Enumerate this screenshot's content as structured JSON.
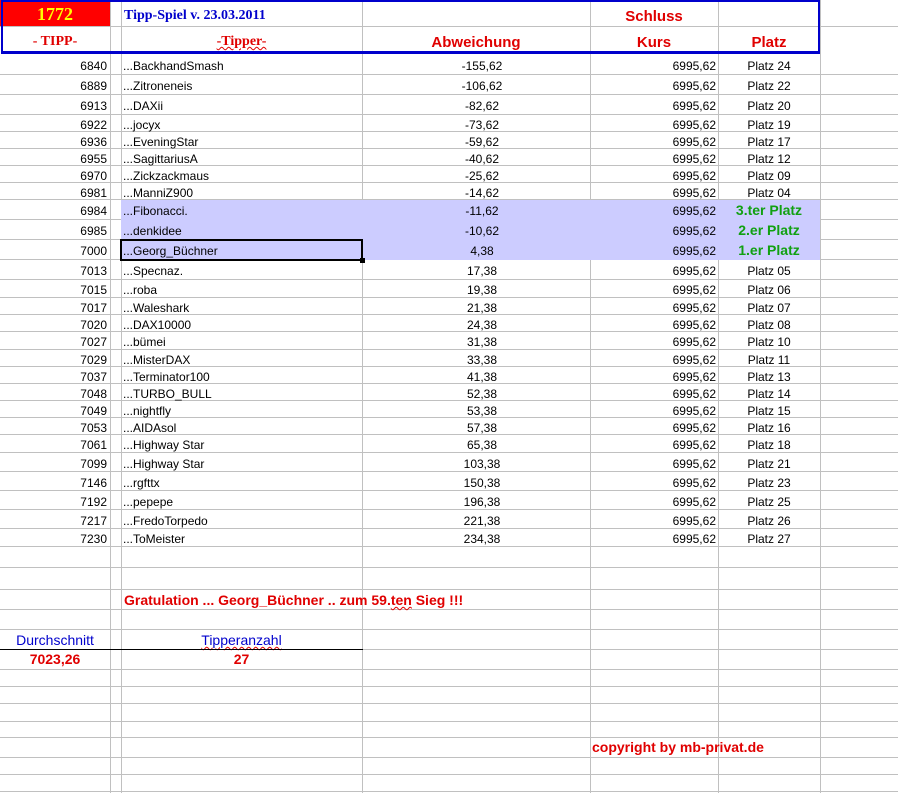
{
  "header": {
    "count": "1772",
    "title": "Tipp-Spiel v. 23.03.2011",
    "schluss": "Schluss",
    "col_tipp": "- TIPP-",
    "col_tipper": "-Tipper-",
    "col_abweichung": "Abweichung",
    "col_kurs": "Kurs",
    "col_platz": "Platz"
  },
  "colors": {
    "accent_red": "#e00000",
    "header_border": "#0000cc",
    "highlight": "#ccccff",
    "winner_green": "#11a011"
  },
  "rows": [
    {
      "tipp": "6840",
      "tipper": "...BackhandSmash",
      "abw": "-155,62",
      "kurs": "6995,62",
      "platz": "Platz 24"
    },
    {
      "tipp": "6889",
      "tipper": "...Zitroneneis",
      "abw": "-106,62",
      "kurs": "6995,62",
      "platz": "Platz 22"
    },
    {
      "tipp": "6913",
      "tipper": "...DAXii",
      "abw": "-82,62",
      "kurs": "6995,62",
      "platz": "Platz 20"
    },
    {
      "tipp": "6922",
      "tipper": "...jocyx",
      "abw": "-73,62",
      "kurs": "6995,62",
      "platz": "Platz 19"
    },
    {
      "tipp": "6936",
      "tipper": "...EveningStar",
      "abw": "-59,62",
      "kurs": "6995,62",
      "platz": "Platz 17"
    },
    {
      "tipp": "6955",
      "tipper": "...SagittariusA",
      "abw": "-40,62",
      "kurs": "6995,62",
      "platz": "Platz 12"
    },
    {
      "tipp": "6970",
      "tipper": "...Zickzackmaus",
      "abw": "-25,62",
      "kurs": "6995,62",
      "platz": "Platz 09"
    },
    {
      "tipp": "6981",
      "tipper": "...ManniZ900",
      "abw": "-14,62",
      "kurs": "6995,62",
      "platz": "Platz 04"
    },
    {
      "tipp": "6984",
      "tipper": "...Fibonacci.",
      "abw": "-11,62",
      "kurs": "6995,62",
      "platz": "3.ter Platz",
      "winner": true
    },
    {
      "tipp": "6985",
      "tipper": "...denkidee",
      "abw": "-10,62",
      "kurs": "6995,62",
      "platz": "2.er Platz",
      "winner": true
    },
    {
      "tipp": "7000",
      "tipper": "...Georg_Büchner",
      "abw": "4,38",
      "kurs": "6995,62",
      "platz": "1.er Platz",
      "winner": true,
      "selected": true
    },
    {
      "tipp": "7013",
      "tipper": "...Specnaz.",
      "abw": "17,38",
      "kurs": "6995,62",
      "platz": "Platz 05"
    },
    {
      "tipp": "7015",
      "tipper": "...roba",
      "abw": "19,38",
      "kurs": "6995,62",
      "platz": "Platz 06"
    },
    {
      "tipp": "7017",
      "tipper": "...Waleshark",
      "abw": "21,38",
      "kurs": "6995,62",
      "platz": "Platz 07"
    },
    {
      "tipp": "7020",
      "tipper": "...DAX10000",
      "abw": "24,38",
      "kurs": "6995,62",
      "platz": "Platz 08"
    },
    {
      "tipp": "7027",
      "tipper": "...bümei",
      "abw": "31,38",
      "kurs": "6995,62",
      "platz": "Platz 10"
    },
    {
      "tipp": "7029",
      "tipper": "...MisterDAX",
      "abw": "33,38",
      "kurs": "6995,62",
      "platz": "Platz 11"
    },
    {
      "tipp": "7037",
      "tipper": "...Terminator100",
      "abw": "41,38",
      "kurs": "6995,62",
      "platz": "Platz 13"
    },
    {
      "tipp": "7048",
      "tipper": "...TURBO_BULL",
      "abw": "52,38",
      "kurs": "6995,62",
      "platz": "Platz 14"
    },
    {
      "tipp": "7049",
      "tipper": "...nightfly",
      "abw": "53,38",
      "kurs": "6995,62",
      "platz": "Platz 15"
    },
    {
      "tipp": "7053",
      "tipper": "...AIDAsol",
      "abw": "57,38",
      "kurs": "6995,62",
      "platz": "Platz 16"
    },
    {
      "tipp": "7061",
      "tipper": "...Highway Star",
      "abw": "65,38",
      "kurs": "6995,62",
      "platz": "Platz 18"
    },
    {
      "tipp": "7099",
      "tipper": "...Highway Star",
      "abw": "103,38",
      "kurs": "6995,62",
      "platz": "Platz 21"
    },
    {
      "tipp": "7146",
      "tipper": "...rgfttx",
      "abw": "150,38",
      "kurs": "6995,62",
      "platz": "Platz 23"
    },
    {
      "tipp": "7192",
      "tipper": "...pepepe",
      "abw": "196,38",
      "kurs": "6995,62",
      "platz": "Platz 25"
    },
    {
      "tipp": "7217",
      "tipper": "...FredoTorpedo",
      "abw": "221,38",
      "kurs": "6995,62",
      "platz": "Platz 26"
    },
    {
      "tipp": "7230",
      "tipper": "...ToMeister",
      "abw": "234,38",
      "kurs": "6995,62",
      "platz": "Platz 27"
    }
  ],
  "footer": {
    "gratulation_a": "Gratulation ... Georg_Büchner .. zum   59.",
    "gratulation_b": "ten",
    "gratulation_c": " Sieg !!!",
    "durchschnitt_label": "Durchschnitt",
    "durchschnitt_value": "7023,26",
    "tipperanzahl_label": "Tipperanzahl",
    "tipperanzahl_value": "27",
    "copyright": "copyright by mb-privat.de"
  }
}
